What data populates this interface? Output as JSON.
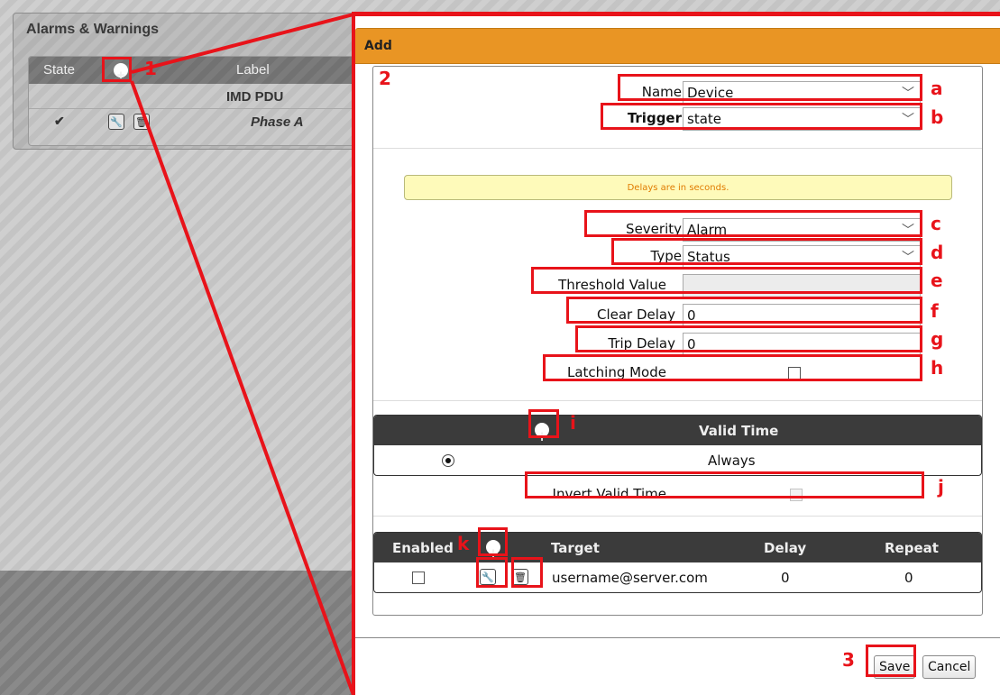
{
  "left_panel": {
    "title": "Alarms & Warnings",
    "columns": {
      "state": "State",
      "label": "Label"
    },
    "group_label": "IMD PDU",
    "row": {
      "label": "Phase A"
    }
  },
  "dialog": {
    "title": "Add",
    "name": {
      "label": "Name",
      "value": "Device"
    },
    "trigger": {
      "label": "Trigger",
      "value": "state"
    },
    "notice": "Delays are in seconds.",
    "severity": {
      "label": "Severity",
      "value": "Alarm"
    },
    "type": {
      "label": "Type",
      "value": "Status"
    },
    "threshold": {
      "label": "Threshold Value",
      "value": ""
    },
    "clear_delay": {
      "label": "Clear Delay",
      "value": "0"
    },
    "trip_delay": {
      "label": "Trip Delay",
      "value": "0"
    },
    "latching": {
      "label": "Latching Mode"
    },
    "valid_time": {
      "header": "Valid Time",
      "row_value": "Always",
      "invert_label": "Invert Valid Time"
    },
    "targets": {
      "headers": {
        "enabled": "Enabled",
        "target": "Target",
        "delay": "Delay",
        "repeat": "Repeat"
      },
      "rows": [
        {
          "target": "username@server.com",
          "delay": "0",
          "repeat": "0"
        }
      ]
    },
    "buttons": {
      "save": "Save",
      "cancel": "Cancel"
    }
  },
  "callouts": {
    "n1": "1",
    "n2": "2",
    "n3": "3",
    "a": "a",
    "b": "b",
    "c": "c",
    "d": "d",
    "e": "e",
    "f": "f",
    "g": "g",
    "h": "h",
    "i": "i",
    "j": "j",
    "k": "k"
  },
  "icons": {
    "add": "plus-circle-icon",
    "edit": "wrench-icon",
    "delete": "trash-icon",
    "check": "checkmark-icon",
    "chevron": "chevron-down-icon"
  },
  "colors": {
    "accent": "#e99524",
    "callout": "#e8131a",
    "grid_header": "#3b3b3b",
    "notice_bg": "#fefaba"
  }
}
